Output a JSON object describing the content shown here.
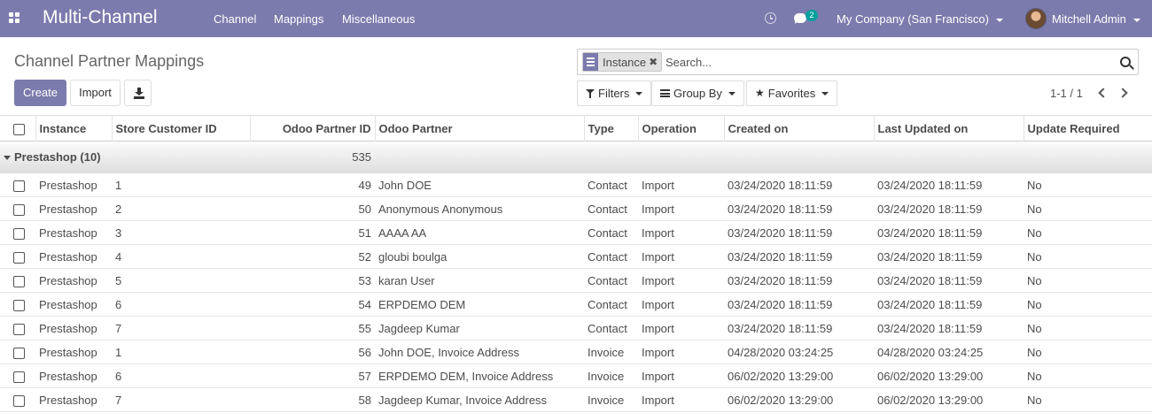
{
  "navbar": {
    "brand": "Multi-Channel",
    "menu": [
      "Channel",
      "Mappings",
      "Miscellaneous"
    ],
    "chat_count": "2",
    "company": "My Company (San Francisco)",
    "user": "Mitchell Admin",
    "color": "#7c7bad"
  },
  "page": {
    "title": "Channel Partner Mappings"
  },
  "search": {
    "facet": "Instance",
    "placeholder": "Search..."
  },
  "buttons": {
    "create": "Create",
    "import": "Import"
  },
  "filters": {
    "filters": "Filters",
    "group_by": "Group By",
    "favorites": "Favorites"
  },
  "pager": {
    "value": "1-1 / 1"
  },
  "table": {
    "columns": [
      "Instance",
      "Store Customer ID",
      "Odoo Partner ID",
      "Odoo Partner",
      "Type",
      "Operation",
      "Created on",
      "Last Updated on",
      "Update Required"
    ],
    "group": {
      "label": "Prestashop (10)",
      "partner_id_sum": "535"
    },
    "rows": [
      {
        "instance": "Prestashop",
        "store_id": "1",
        "partner_id": "49",
        "partner": "John DOE",
        "type": "Contact",
        "operation": "Import",
        "created": "03/24/2020 18:11:59",
        "updated": "03/24/2020 18:11:59",
        "update_required": "No"
      },
      {
        "instance": "Prestashop",
        "store_id": "2",
        "partner_id": "50",
        "partner": "Anonymous Anonymous",
        "type": "Contact",
        "operation": "Import",
        "created": "03/24/2020 18:11:59",
        "updated": "03/24/2020 18:11:59",
        "update_required": "No"
      },
      {
        "instance": "Prestashop",
        "store_id": "3",
        "partner_id": "51",
        "partner": "AAAA AA",
        "type": "Contact",
        "operation": "Import",
        "created": "03/24/2020 18:11:59",
        "updated": "03/24/2020 18:11:59",
        "update_required": "No"
      },
      {
        "instance": "Prestashop",
        "store_id": "4",
        "partner_id": "52",
        "partner": "gloubi boulga",
        "type": "Contact",
        "operation": "Import",
        "created": "03/24/2020 18:11:59",
        "updated": "03/24/2020 18:11:59",
        "update_required": "No"
      },
      {
        "instance": "Prestashop",
        "store_id": "5",
        "partner_id": "53",
        "partner": "karan User",
        "type": "Contact",
        "operation": "Import",
        "created": "03/24/2020 18:11:59",
        "updated": "03/24/2020 18:11:59",
        "update_required": "No"
      },
      {
        "instance": "Prestashop",
        "store_id": "6",
        "partner_id": "54",
        "partner": "ERPDEMO DEM",
        "type": "Contact",
        "operation": "Import",
        "created": "03/24/2020 18:11:59",
        "updated": "03/24/2020 18:11:59",
        "update_required": "No"
      },
      {
        "instance": "Prestashop",
        "store_id": "7",
        "partner_id": "55",
        "partner": "Jagdeep Kumar",
        "type": "Contact",
        "operation": "Import",
        "created": "03/24/2020 18:11:59",
        "updated": "03/24/2020 18:11:59",
        "update_required": "No"
      },
      {
        "instance": "Prestashop",
        "store_id": "1",
        "partner_id": "56",
        "partner": "John DOE, Invoice Address",
        "type": "Invoice",
        "operation": "Import",
        "created": "04/28/2020 03:24:25",
        "updated": "04/28/2020 03:24:25",
        "update_required": "No"
      },
      {
        "instance": "Prestashop",
        "store_id": "6",
        "partner_id": "57",
        "partner": "ERPDEMO DEM, Invoice Address",
        "type": "Invoice",
        "operation": "Import",
        "created": "06/02/2020 13:29:00",
        "updated": "06/02/2020 13:29:00",
        "update_required": "No"
      },
      {
        "instance": "Prestashop",
        "store_id": "7",
        "partner_id": "58",
        "partner": "Jagdeep Kumar, Invoice Address",
        "type": "Invoice",
        "operation": "Import",
        "created": "06/02/2020 13:29:00",
        "updated": "06/02/2020 13:29:00",
        "update_required": "No"
      }
    ]
  }
}
